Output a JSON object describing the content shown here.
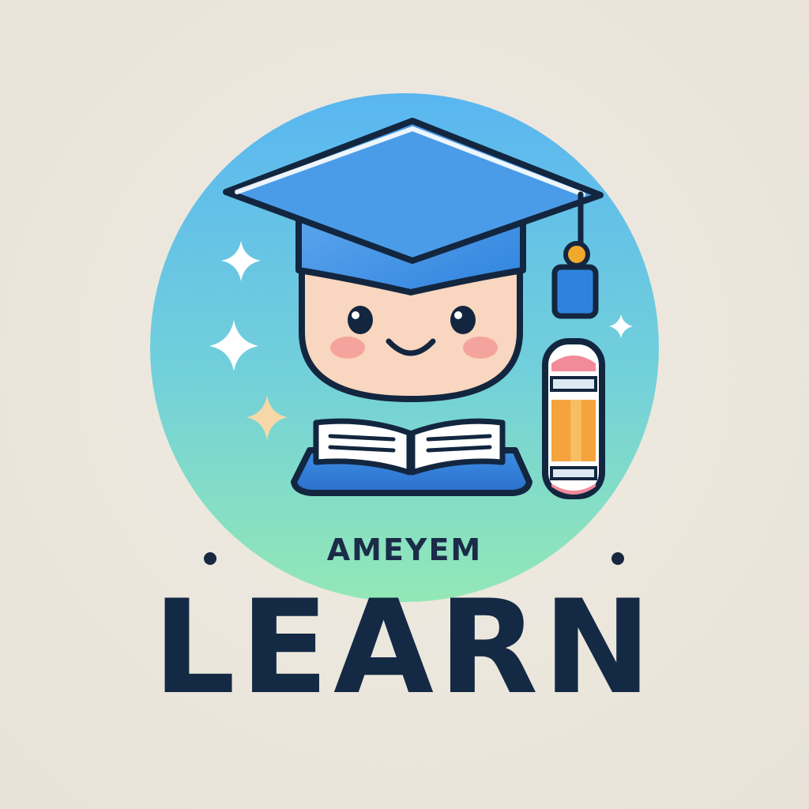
{
  "brand": {
    "subtitle": "AMEYEM",
    "title": "LEARN"
  },
  "colors": {
    "background": "#ece7de",
    "circle_top": "#5ab8f0",
    "circle_bottom": "#8ee6b8",
    "cap_blue": "#3f94e6",
    "outline": "#13263f",
    "text": "#142a44",
    "skin": "#f8d5bd",
    "cheek": "#f3a7a0",
    "tassel_knob": "#f0a92c",
    "pencil_orange": "#f5a33d",
    "pencil_eraser": "#f28a9a"
  },
  "icons": [
    "graduation-cap-icon",
    "smiling-face-icon",
    "open-book-icon",
    "pencil-icon",
    "sparkle-icon"
  ]
}
